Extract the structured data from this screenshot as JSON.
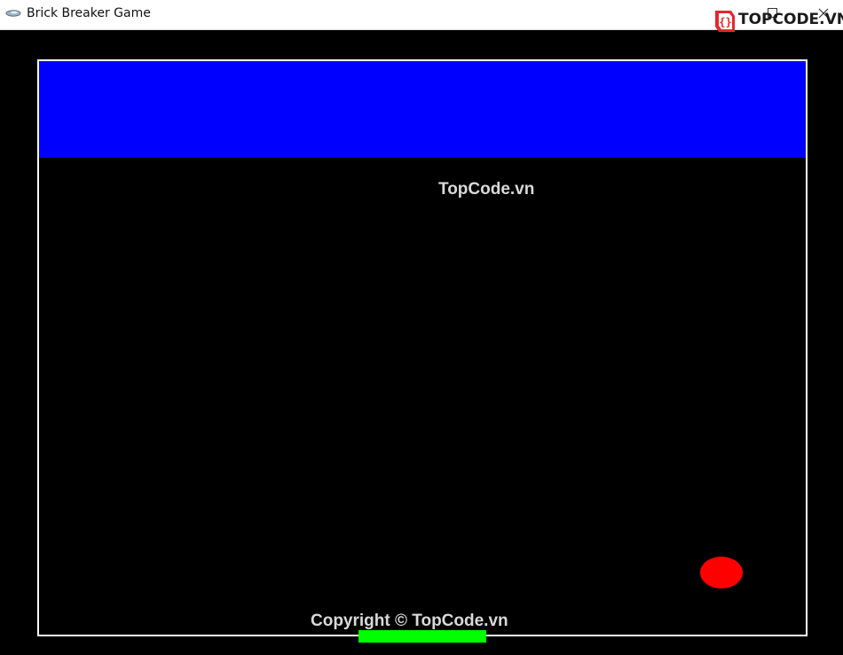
{
  "window": {
    "title": "Brick Breaker Game",
    "icon": "app-icon",
    "controls": {
      "maximize_icon": "maximize-icon",
      "close_icon": "close-icon",
      "close_glyph": "✕"
    }
  },
  "logo": {
    "text_top": "TOP",
    "text_rest": "CODE.VN",
    "accent_color": "#e8262b"
  },
  "game": {
    "background_color": "#000000",
    "border_color": "#ffffff",
    "brick_color": "#0000ff",
    "ball_color": "#ff0000",
    "paddle_color": "#00ff00"
  },
  "overlay": {
    "watermark": "TopCode.vn",
    "copyright": "Copyright © TopCode.vn"
  }
}
